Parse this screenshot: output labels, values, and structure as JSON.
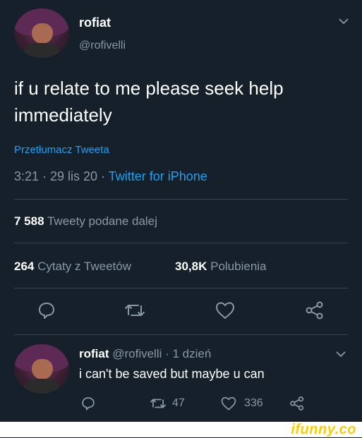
{
  "tweet": {
    "display_name": "rofiat",
    "handle": "@rofivelli",
    "text_line1": "if u relate to me please seek help",
    "text_line2": "immediately",
    "translate_link": "Przetłumacz Tweeta",
    "time_date": "3:21 · 29 lis 20 · ",
    "source": "Twitter for iPhone"
  },
  "stats": {
    "retweets_count": "7 588",
    "retweets_label": "Tweety podane dalej",
    "quotes_count": "264",
    "quotes_label": "Cytaty z Tweetów",
    "likes_count": "30,8K",
    "likes_label": "Polubienia"
  },
  "reply": {
    "display_name": "rofiat",
    "meta": "@rofivelli · 1 dzień",
    "text": "i can't be saved but maybe u can",
    "retweets": "47",
    "likes": "336"
  },
  "watermark": "ifunny.co",
  "colors": {
    "background": "#15202b",
    "accent": "#1da1f2",
    "muted": "#8899a6",
    "separator": "#38444d"
  },
  "icons": [
    "chevron-down-icon",
    "reply-icon",
    "retweet-icon",
    "heart-icon",
    "share-icon"
  ]
}
